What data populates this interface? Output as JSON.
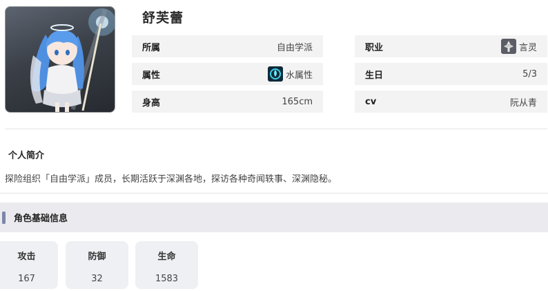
{
  "character": {
    "name": "舒芙蕾"
  },
  "info": {
    "affiliation": {
      "label": "所属",
      "value": "自由学派"
    },
    "class": {
      "label": "职业",
      "value": "言灵",
      "icon": "class-emblem-icon"
    },
    "attribute": {
      "label": "属性",
      "value": "水属性",
      "icon": "water-element-icon"
    },
    "birthday": {
      "label": "生日",
      "value": "5/3"
    },
    "height": {
      "label": "身高",
      "value": "165cm"
    },
    "cv": {
      "label": "cv",
      "value": "阮从青"
    }
  },
  "profile": {
    "title": "个人简介",
    "text": "探险组织「自由学派」成员，长期活跃于深渊各地，探访各种奇闻轶事、深渊隐秘。"
  },
  "basic_info": {
    "title": "角色基础信息",
    "stats": [
      {
        "label": "攻击",
        "value": "167"
      },
      {
        "label": "防御",
        "value": "32"
      },
      {
        "label": "生命",
        "value": "1583"
      }
    ]
  },
  "colors": {
    "accent_bar": "#7c86a8",
    "row_bg": "#f3f3f3",
    "card_bg": "#eef0f3"
  }
}
